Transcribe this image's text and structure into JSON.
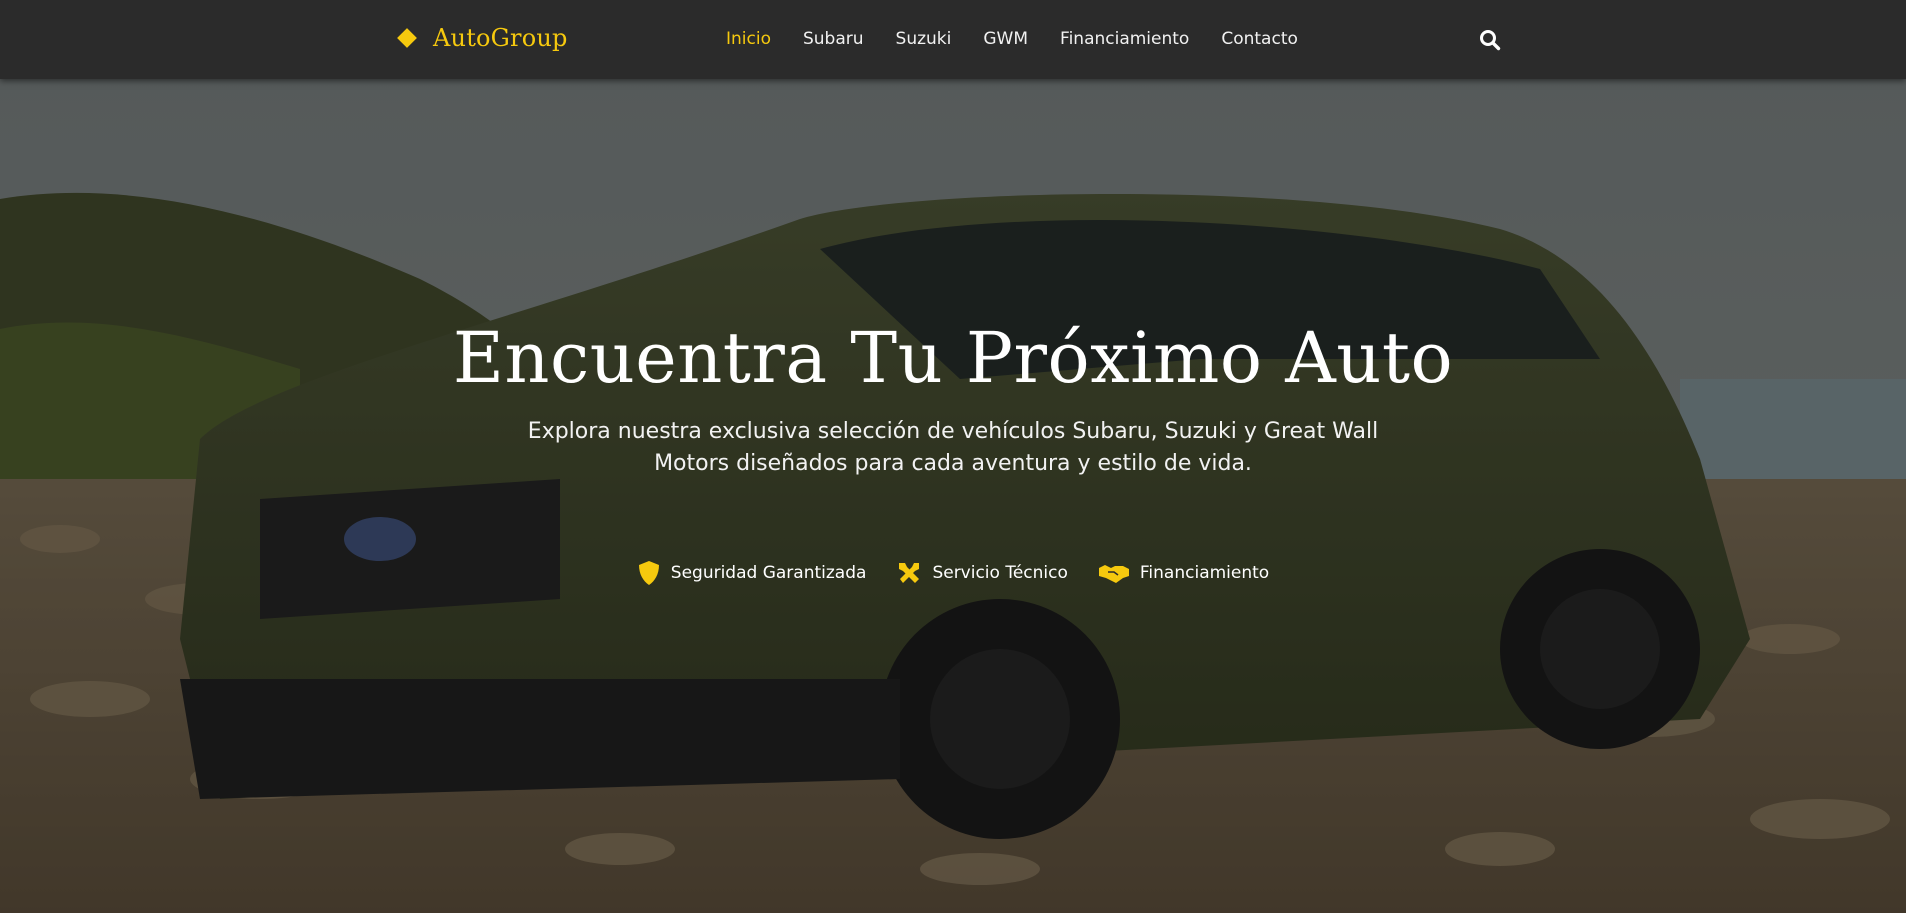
{
  "nav": {
    "logo_text": "AutoGroup",
    "links": [
      "Inicio",
      "Subaru",
      "Suzuki",
      "GWM",
      "Financiamiento",
      "Contacto"
    ],
    "active": "Inicio",
    "search_icon": "search-icon"
  },
  "hero": {
    "title": "Encuentra Tu Próximo Auto",
    "subtitle": "Explora nuestra exclusiva selección de vehículos Subaru, Suzuki y Great Wall Motors diseñados para cada aventura y estilo de vida.",
    "features": [
      {
        "icon": "shield-icon",
        "label": "Seguridad Garantizada"
      },
      {
        "icon": "tools-icon",
        "label": "Servicio Técnico"
      },
      {
        "icon": "handshake-icon",
        "label": "Financiamiento"
      }
    ]
  },
  "colors": {
    "accent": "#f6c90e",
    "navbar_bg": "#2b2b2b",
    "text_light": "#ffffff"
  }
}
